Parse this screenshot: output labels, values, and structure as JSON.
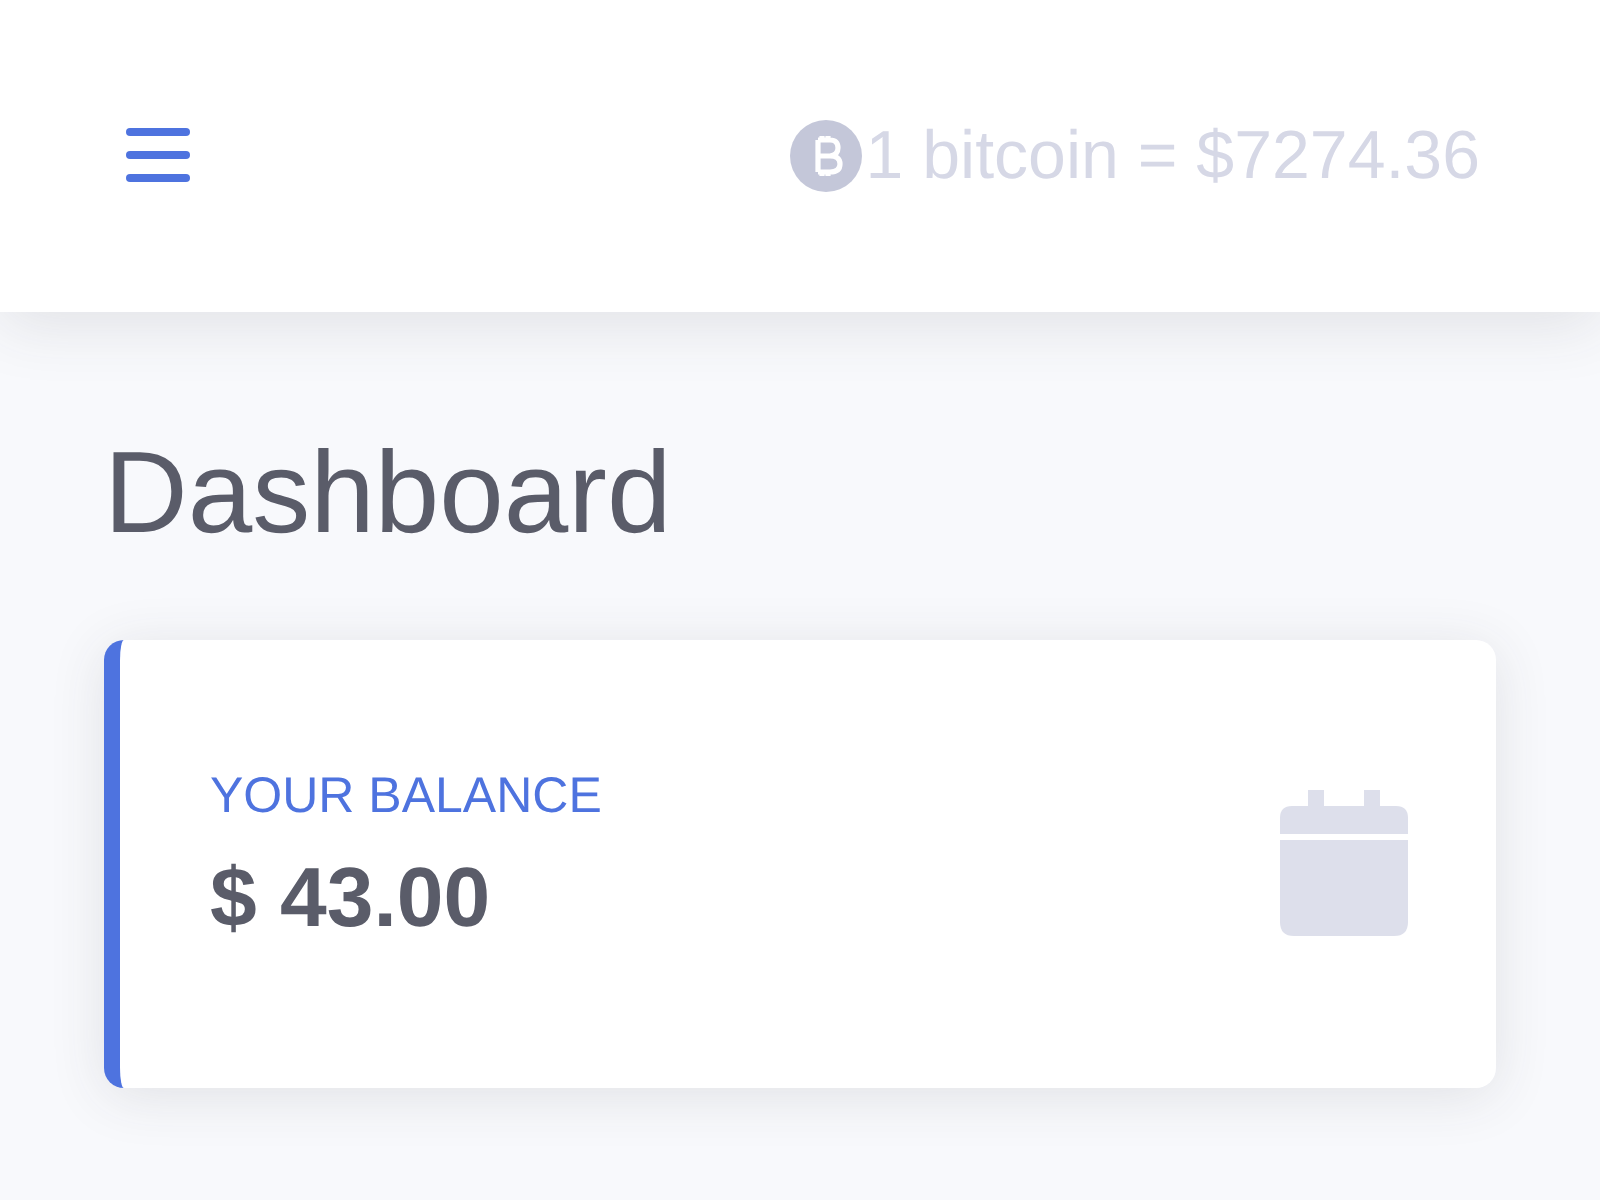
{
  "topbar": {
    "rate": "1 bitcoin = $7274.36"
  },
  "page": {
    "title": "Dashboard"
  },
  "cards": [
    {
      "label": "YOUR BALANCE",
      "value": "$ 43.00"
    }
  ]
}
